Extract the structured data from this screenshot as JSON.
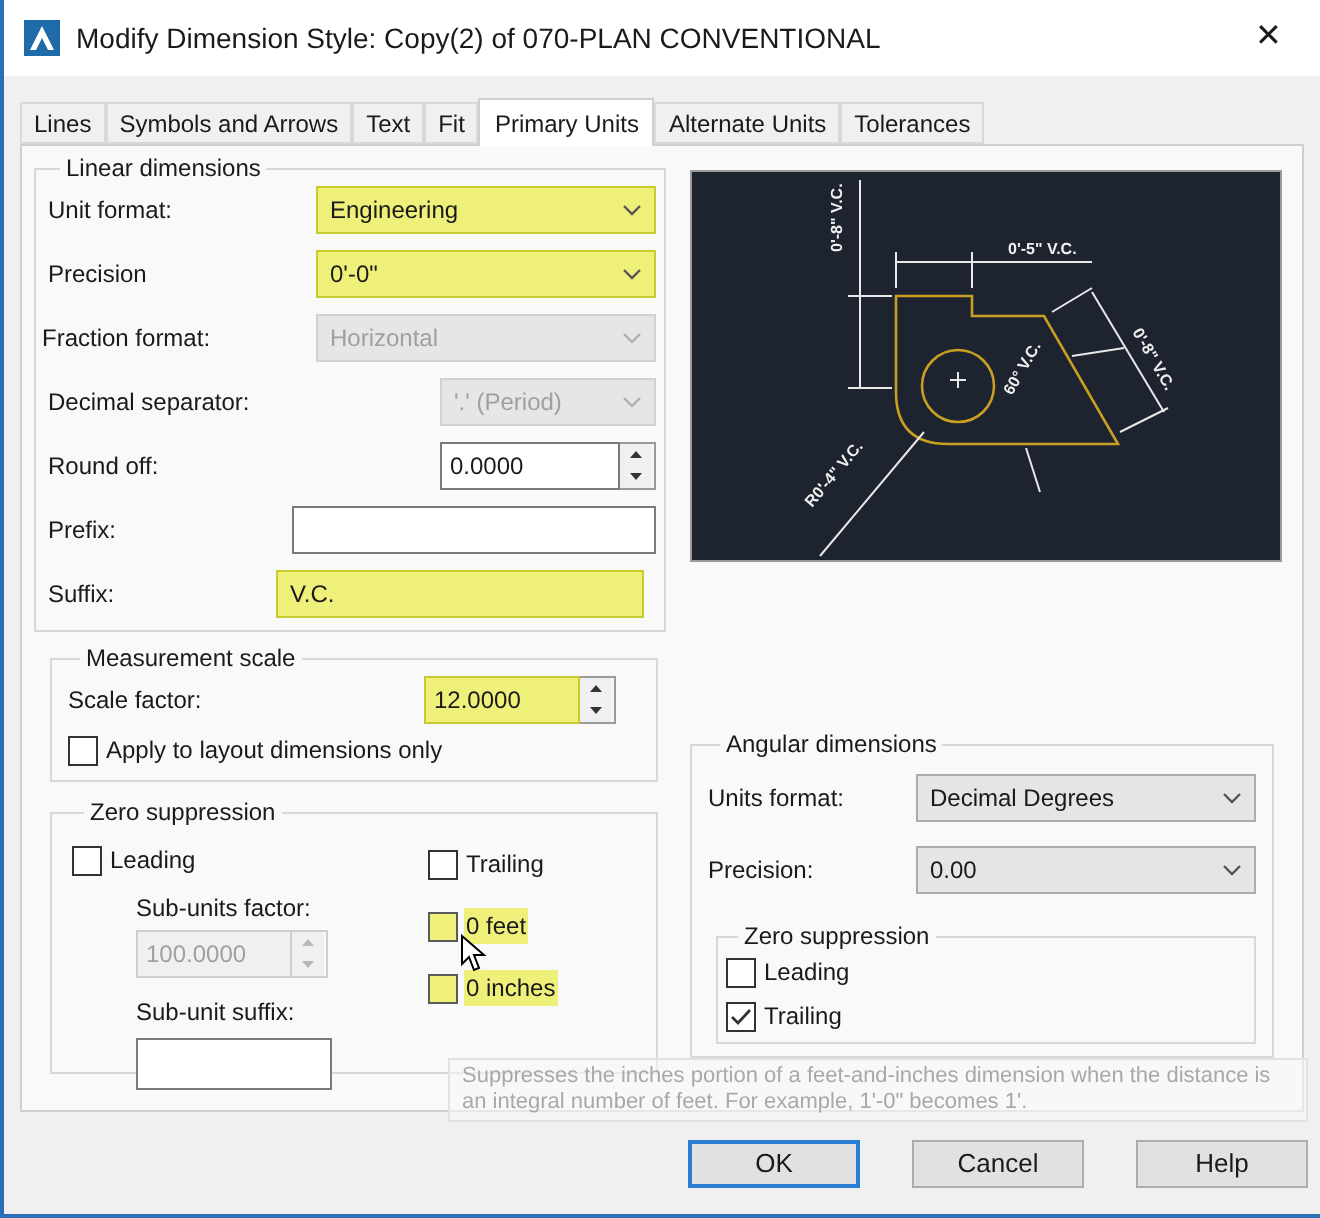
{
  "window": {
    "title": "Modify Dimension Style: Copy(2) of 070-PLAN CONVENTIONAL",
    "close": "✕"
  },
  "tabs": [
    {
      "label": "Lines",
      "selected": false
    },
    {
      "label": "Symbols and Arrows",
      "selected": false
    },
    {
      "label": "Text",
      "selected": false
    },
    {
      "label": "Fit",
      "selected": false
    },
    {
      "label": "Primary Units",
      "selected": true
    },
    {
      "label": "Alternate Units",
      "selected": false
    },
    {
      "label": "Tolerances",
      "selected": false
    }
  ],
  "linear_dimensions": {
    "title": "Linear dimensions",
    "fields": [
      {
        "kind": "dropdown",
        "label": "Unit format:",
        "value": "Engineering",
        "disabled": false,
        "highlighted": true
      },
      {
        "kind": "dropdown",
        "label": "Precision",
        "value": "0'-0\"",
        "disabled": false,
        "highlighted": true
      },
      {
        "kind": "dropdown",
        "label": "Fraction format:",
        "value": "Horizontal",
        "disabled": true,
        "highlighted": false
      },
      {
        "kind": "dropdown",
        "label": "Decimal separator:",
        "value": "'.' (Period)",
        "disabled": true,
        "highlighted": false
      },
      {
        "kind": "spinner",
        "label": "Round off:",
        "value": "0.0000",
        "disabled": false,
        "highlighted": false
      },
      {
        "kind": "text",
        "label": "Prefix:",
        "disabled": false,
        "highlighted": false
      },
      {
        "kind": "text",
        "label": "Suffix:",
        "value": "V.C.",
        "disabled": false,
        "highlighted": true
      }
    ]
  },
  "measurement_scale": {
    "title": "Measurement scale",
    "scale_factor": {
      "label": "Scale factor:",
      "value": "12.0000",
      "highlighted": true
    },
    "apply_layout": {
      "label": "Apply to layout dimensions only",
      "checked": false
    }
  },
  "zero_suppression": {
    "title": "Zero suppression",
    "leading": {
      "label": "Leading",
      "checked": false
    },
    "sub_units_factor": {
      "label": "Sub-units factor:",
      "value": "100.0000",
      "disabled": true
    },
    "sub_unit_suffix": {
      "label": "Sub-unit suffix:"
    },
    "trailing": {
      "label": "Trailing",
      "checked": false,
      "highlighted": false
    },
    "feet": {
      "label": "0 feet",
      "checked": false,
      "highlighted": true
    },
    "inches": {
      "label": "0 inches",
      "checked": false,
      "highlighted": true
    }
  },
  "preview": {
    "labels": [
      "0'-8\" V.C.",
      "0'-5\" V.C.",
      "0'-8\" V.C.",
      "60° V.C.",
      "R0'-4\" V.C."
    ]
  },
  "angular": {
    "title": "Angular dimensions",
    "units_format": {
      "label": "Units format:",
      "value": "Decimal Degrees"
    },
    "precision": {
      "label": "Precision:",
      "value": "0.00"
    },
    "zero_suppression": {
      "title": "Zero suppression",
      "leading": {
        "label": "Leading",
        "checked": false
      },
      "trailing": {
        "label": "Trailing",
        "checked": true
      }
    }
  },
  "tooltip": {
    "text": "Suppresses the inches portion of a feet-and-inches dimension when the distance is an integral number of feet. For example, 1'-0\" becomes 1'."
  },
  "buttons": [
    {
      "label": "OK",
      "default": true
    },
    {
      "label": "Cancel",
      "default": false
    },
    {
      "label": "Help",
      "default": false
    }
  ]
}
